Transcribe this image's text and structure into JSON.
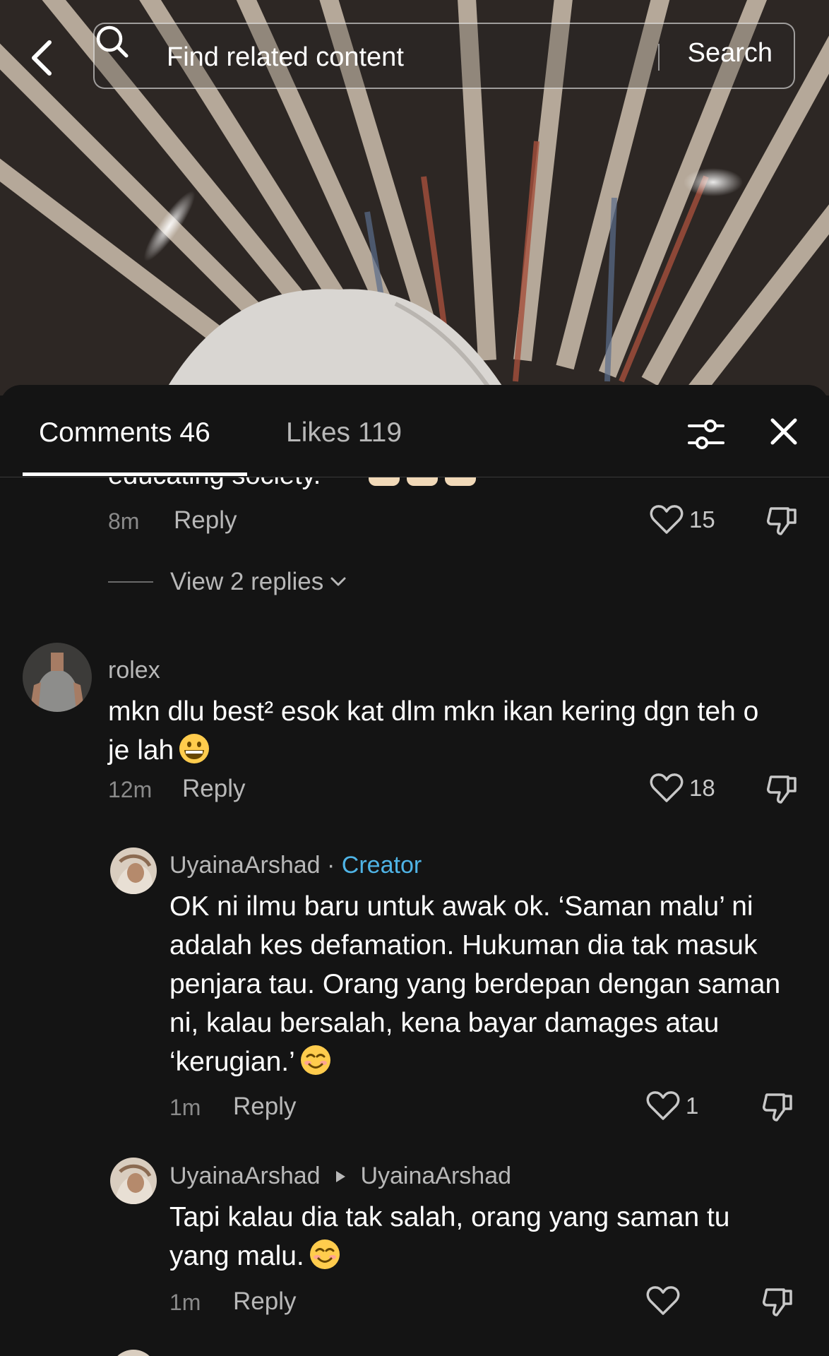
{
  "search": {
    "placeholder": "Find related content",
    "button_label": "Search"
  },
  "tabs": {
    "comments_label": "Comments 46",
    "likes_label": "Likes 119"
  },
  "previous_comment": {
    "text_tail": "educating society.",
    "time": "8m",
    "reply_label": "Reply",
    "likes": "15",
    "view_replies_label": "View 2 replies"
  },
  "comments": [
    {
      "username": "rolex",
      "text": "mkn dlu best² esok kat dlm mkn ikan kering dgn teh o je lah",
      "time": "12m",
      "reply_label": "Reply",
      "likes": "18",
      "emoji": "grinning-face"
    }
  ],
  "replies": [
    {
      "username": "UyainaArshad",
      "separator": "·",
      "badge": "Creator",
      "text": "OK ni ilmu baru untuk awak ok. ‘Saman malu’ ni adalah kes defamation. Hukuman dia tak masuk penjara tau. Orang yang berdepan dengan saman ni, kalau bersalah, kena bayar damages atau ‘kerugian.’",
      "time": "1m",
      "reply_label": "Reply",
      "likes": "1",
      "emoji": "smiling-face"
    },
    {
      "username": "UyainaArshad",
      "reply_to": "UyainaArshad",
      "text": "Tapi kalau dia tak salah, orang yang saman tu yang malu.",
      "time": "1m",
      "reply_label": "Reply",
      "likes": "",
      "emoji": "smiling-face"
    }
  ],
  "colors": {
    "background": "#141414",
    "accent_creator": "#4fb4e6",
    "secondary_text": "#b8b8b8"
  },
  "icons": [
    "back-arrow-icon",
    "search-icon",
    "filter-sliders-icon",
    "close-icon",
    "heart-icon",
    "dislike-icon",
    "chevron-down-icon"
  ]
}
